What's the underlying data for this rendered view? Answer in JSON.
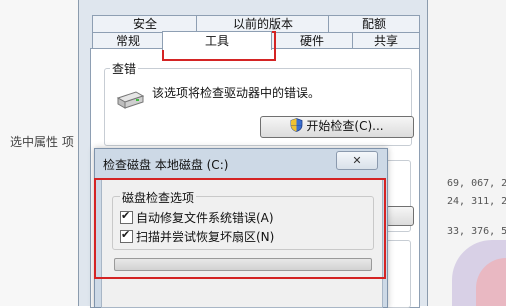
{
  "background": {
    "left_text": "选中属性 项",
    "right_numbers": [
      "69, 067, 2",
      "24, 311, 2",
      "33, 376, 5"
    ]
  },
  "dialog": {
    "tabs_row1": [
      "安全",
      "以前的版本",
      "配额"
    ],
    "tabs_row2": [
      "常规",
      "工具",
      "硬件",
      "共享"
    ],
    "active_tab": "工具",
    "error_check": {
      "group_title": "查错",
      "description": "该选项将检查驱动器中的错误。",
      "button_label": "开始检查(C)..."
    }
  },
  "check_disk": {
    "title": "检查磁盘 本地磁盘 (C:)",
    "close_label": "✕",
    "options_group": "磁盘检查选项",
    "options": [
      {
        "label": "自动修复文件系统错误(A)",
        "checked": true
      },
      {
        "label": "扫描并尝试恢复坏扇区(N)",
        "checked": true
      }
    ],
    "progress": 0
  },
  "icons": {
    "drive": "hard-drive-icon",
    "shield": "uac-shield-icon",
    "close": "close-icon"
  },
  "colors": {
    "highlight": "#d42424",
    "tab_border": "#8e9fb3",
    "window_frame": "#cdd9e6"
  }
}
